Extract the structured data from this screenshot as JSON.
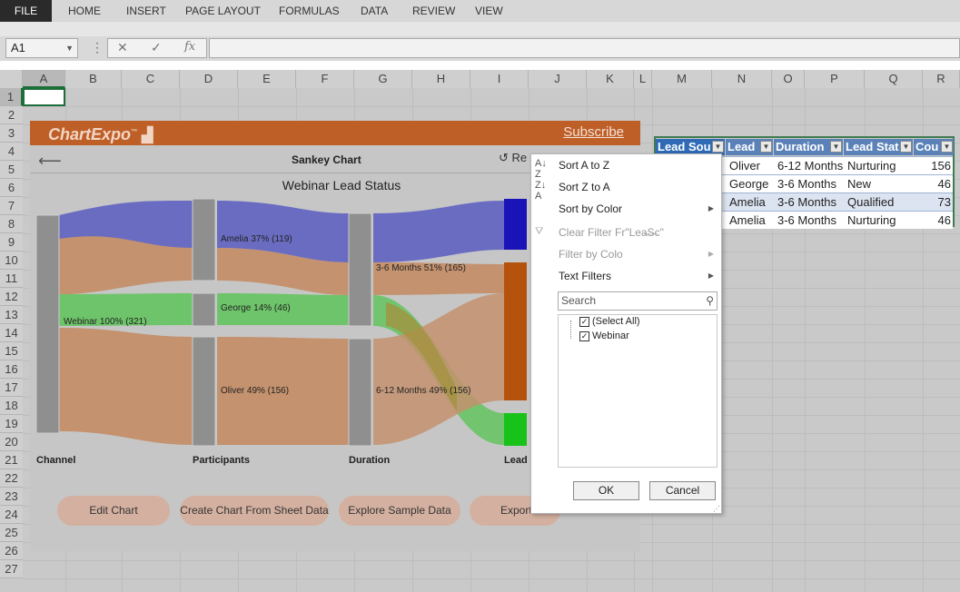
{
  "ribbon": {
    "tabs": [
      "FILE",
      "HOME",
      "INSERT",
      "PAGE LAYOUT",
      "FORMULAS",
      "DATA",
      "REVIEW",
      "VIEW"
    ]
  },
  "formula_bar": {
    "name_box": "A1",
    "fx": "fx",
    "cancel": "✕",
    "enter": "✓",
    "formula": ""
  },
  "columns": [
    "A",
    "B",
    "C",
    "D",
    "E",
    "F",
    "G",
    "H",
    "I",
    "J",
    "K",
    "L",
    "M",
    "N",
    "O",
    "P",
    "Q",
    "R"
  ],
  "rows": [
    "1",
    "2",
    "3",
    "4",
    "5",
    "6",
    "7",
    "8",
    "9",
    "10",
    "11",
    "12",
    "13",
    "14",
    "15",
    "16",
    "17",
    "18",
    "19",
    "20",
    "21",
    "22",
    "23",
    "24",
    "25",
    "26",
    "27"
  ],
  "addin": {
    "logo": "ChartExpo",
    "logo_tm": "™",
    "subscribe": "Subscribe",
    "chart_name": "Sankey Chart",
    "refresh_label": "Re",
    "chart_title": "Webinar Lead Status",
    "labels": {
      "webinar": "Webinar 100% (321)",
      "amelia": "Amelia 37% (119)",
      "george": "George 14% (46)",
      "oliver": "Oliver 49% (156)",
      "m36": "3-6 Months 51% (165)",
      "m612": "6-12 Months 49% (156)"
    },
    "axes": [
      "Channel",
      "Participants",
      "Duration",
      "Lead"
    ],
    "buttons": [
      "Edit Chart",
      "Create Chart From Sheet Data",
      "Explore Sample Data",
      "Export"
    ]
  },
  "table": {
    "headers": [
      "Lead Sou",
      "Lead",
      "Duration",
      "Lead Stat",
      "Cou"
    ],
    "rows": [
      [
        "Oliver",
        "6-12 Months",
        "Nurturing",
        "156"
      ],
      [
        "George",
        "3-6 Months",
        "New",
        "46"
      ],
      [
        "Amelia",
        "3-6 Months",
        "Qualified",
        "73"
      ],
      [
        "Amelia",
        "3-6 Months",
        "Nurturing",
        "46"
      ]
    ]
  },
  "filter_menu": {
    "sort_az": "Sort A to Z",
    "sort_za": "Sort Z to A",
    "sort_color": "Sort by Color",
    "clear_filter": "Clear Filter Fr\"Lea̶S̶c\"",
    "filter_color": "Filter by Colo",
    "text_filters": "Text Filters",
    "search_placeholder": "Search",
    "items": [
      "(Select All)",
      "Webinar"
    ],
    "ok": "OK",
    "cancel": "Cancel"
  },
  "colors": {
    "purple": "#6a6cc2",
    "orange_flow": "#c4926e",
    "green": "#6ec46a",
    "olive": "#a2923e",
    "node_gray": "#8f8f8f",
    "blue_node": "#1a13b8",
    "orange_node": "#b5520e",
    "green_node": "#18c218",
    "accent": "#bf5f28"
  }
}
